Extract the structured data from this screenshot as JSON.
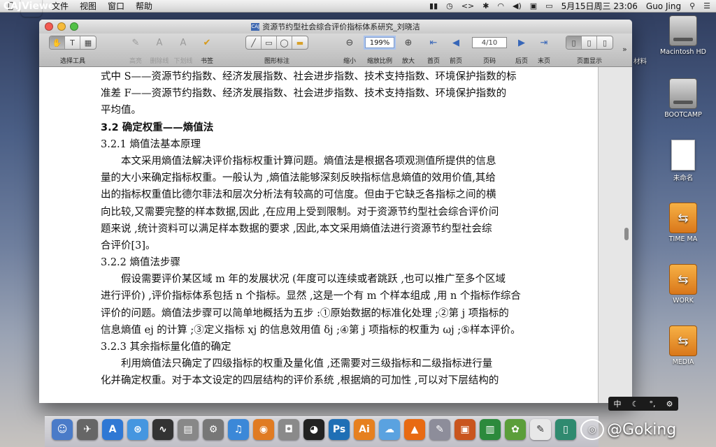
{
  "menubar": {
    "app_name": "CAJViewer",
    "items": [
      "文件",
      "视图",
      "窗口",
      "帮助"
    ],
    "datetime": "5月15日周三  23:06",
    "user": "Guo Jing"
  },
  "window": {
    "title": "资源节约型社会综合评价指标体系研究_刘晓洁"
  },
  "toolbar": {
    "select_tools_label": "选择工具",
    "highlight_label": "高亮",
    "strikethrough_label": "删除线",
    "underline_label": "下划线",
    "bookmark_label": "书签",
    "shape_annot_label": "图形标注",
    "zoom_out_label": "缩小",
    "zoom_ratio_label": "缩放比例",
    "zoom_value": "199%",
    "zoom_in_label": "放大",
    "first_page_label": "首页",
    "prev_page_label": "前页",
    "page_value": "4/10",
    "page_label": "页码",
    "next_page_label": "后页",
    "last_page_label": "末页",
    "page_display_label": "页面显示"
  },
  "document": {
    "lines": [
      "式中 S——资源节约指数、经济发展指数、社会进步指数、技术支持指数、环境保护指数的标",
      "准差 F——资源节约指数、经济发展指数、社会进步指数、技术支持指数、环境保护指数的",
      "平均值。",
      "3.2  确定权重——熵值法",
      "3.2.1    熵值法基本原理",
      "本文采用熵值法解决评价指标权重计算问题。熵值法是根据各项观测值所提供的信息",
      "量的大小来确定指标权重。一般认为 ,熵值法能够深刻反映指标信息熵值的效用价值,其给",
      "出的指标权重值比德尔菲法和层次分析法有较高的可信度。但由于它缺乏各指标之间的横",
      "向比较,又需要完整的样本数据,因此 ,在应用上受到限制。对于资源节约型社会综合评价问",
      "题来说 ,统计资料可以满足样本数据的要求 ,因此,本文采用熵值法进行资源节约型社会综",
      "合评价[3]。",
      "3.2.2    熵值法步骤",
      "假设需要评价某区域 m 年的发展状况 (年度可以连续或者跳跃 ,也可以推广至多个区域",
      "进行评价) ,评价指标体系包括 n 个指标。显然 ,这是一个有 m 个样本组成 ,用 n 个指标作综合",
      "评价的问题。熵值法步骤可以简单地概括为五步 :①原始数据的标准化处理 ;②第 j 项指标的",
      "信息熵值 ej 的计算 ;③定义指标 xj 的信息效用值 δj ;④第 j 项指标的权重为 ωj ;⑤样本评价。",
      "3.2.3    其余指标量化值的确定",
      "利用熵值法只确定了四级指标的权重及量化值 ,还需要对三级指标和二级指标进行量",
      "化并确定权重。对于本文设定的四层结构的评价系统 ,根据熵的可加性 ,可以对下层结构的"
    ]
  },
  "desktop": {
    "partial_label": "材料",
    "icons": [
      {
        "name": "Macintosh HD",
        "kind": "hdd"
      },
      {
        "name": "BOOTCAMP",
        "kind": "hdd"
      },
      {
        "name": "未命名",
        "kind": "blank"
      },
      {
        "name": "TIME MA",
        "kind": "usb"
      },
      {
        "name": "WORK",
        "kind": "usb"
      },
      {
        "name": "MEDIA",
        "kind": "usb"
      }
    ]
  },
  "ime": {
    "label": "中"
  },
  "watermark": {
    "text": "@Goking"
  }
}
